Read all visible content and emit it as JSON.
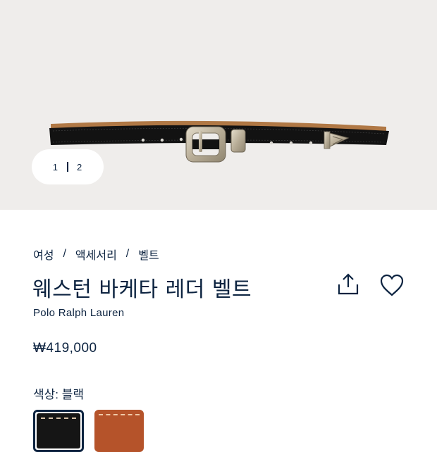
{
  "gallery": {
    "current": "1",
    "total": "2"
  },
  "breadcrumb": [
    "여성",
    "액세서리",
    "벨트"
  ],
  "breadcrumb_separator": "/",
  "product": {
    "title": "웨스턴 바케타 레더 벨트",
    "brand": "Polo Ralph Lauren",
    "price": "₩419,000"
  },
  "color": {
    "label": "색상:",
    "selected": "블랙",
    "swatches": [
      {
        "name": "black",
        "hex": "#151515",
        "selected": true
      },
      {
        "name": "brown",
        "hex": "#b5532a",
        "selected": false
      }
    ]
  },
  "icons": {
    "share": "share-icon",
    "favorite": "heart-icon"
  },
  "colors": {
    "text": "#0c2340",
    "hero_bg": "#efedeb"
  }
}
